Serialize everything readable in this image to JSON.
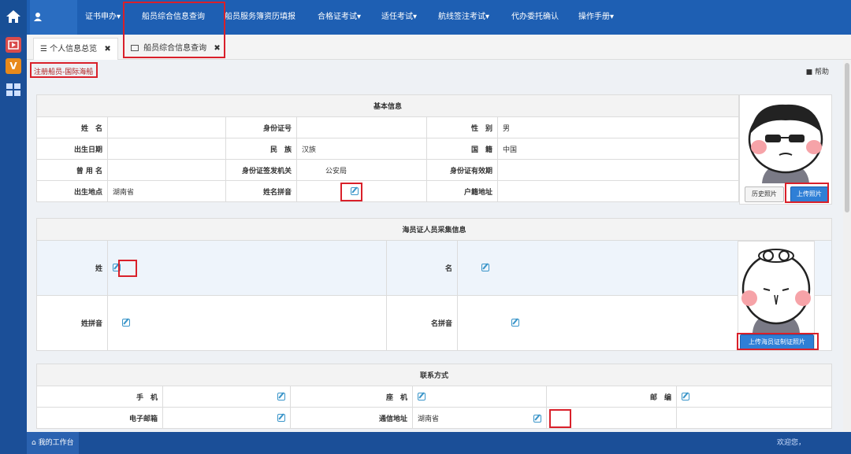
{
  "nav": {
    "items": [
      "证书申办▾",
      "船员综合信息查询",
      "船员服务簿资历填报",
      "合格证考试▾",
      "适任考试▾",
      "航线签注考试▾",
      "代办委托确认",
      "操作手册▾"
    ]
  },
  "tabs": [
    {
      "label": "个人信息总览"
    },
    {
      "label": "船员综合信息查询"
    }
  ],
  "breadcrumb": "注册船员-国际海船",
  "help": "帮助",
  "basic": {
    "section": "基本信息",
    "labels": {
      "name": "姓　名",
      "id_no": "身份证号",
      "gender": "性　别",
      "birth": "出生日期",
      "ethnic": "民　族",
      "nation": "国　籍",
      "former_name": "曾 用 名",
      "issuer": "身份证签发机关",
      "valid": "身份证有效期",
      "birthplace": "出生地点",
      "pinyin": "姓名拼音",
      "household": "户籍地址"
    },
    "values": {
      "gender": "男",
      "ethnic": "汉族",
      "nation": "中国",
      "issuer": "公安局",
      "birthplace": "湖南省"
    },
    "btn_history": "历史照片",
    "btn_upload": "上传照片"
  },
  "seafarer": {
    "section": "海员证人员采集信息",
    "labels": {
      "surname": "姓",
      "given": "名",
      "surname_py": "姓拼音",
      "given_py": "名拼音"
    },
    "btn_upload": "上传海员证制证照片"
  },
  "contact": {
    "section": "联系方式",
    "labels": {
      "mobile": "手　机",
      "phone": "座　机",
      "zip": "邮　编",
      "email": "电子邮箱",
      "address": "通信地址"
    },
    "values": {
      "address": "湖南省"
    }
  },
  "bottom": {
    "workspace": "我的工作台",
    "welcome": "欢迎您，"
  },
  "colors": {
    "nav": "#1e5fb3",
    "highlight": "#d9202a",
    "button": "#2f7fd6"
  }
}
